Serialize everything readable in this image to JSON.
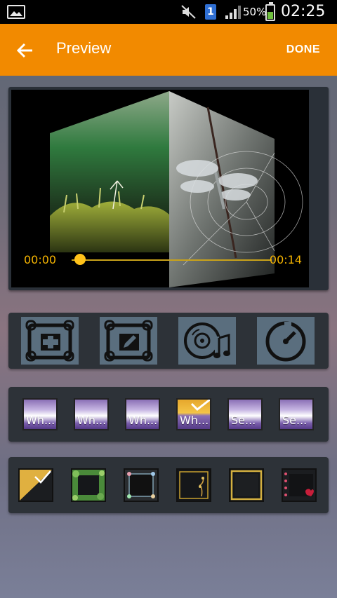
{
  "status_bar": {
    "battery_percent": "50%",
    "time": "02:25",
    "sim_slot": "1",
    "icons": [
      "gallery-icon",
      "mute-icon",
      "sim-icon",
      "signal-icon",
      "battery-icon"
    ]
  },
  "toolbar": {
    "title": "Preview",
    "done_label": "DONE",
    "accent_color": "#f28a00"
  },
  "player": {
    "current_time": "00:00",
    "total_time": "00:14",
    "progress": 0.0,
    "accent_color": "#ffc21a"
  },
  "tools": [
    {
      "name": "add-photo-icon"
    },
    {
      "name": "edit-photo-icon"
    },
    {
      "name": "music-disc-icon"
    },
    {
      "name": "duration-timer-icon"
    }
  ],
  "themes": [
    {
      "label": "Wh..."
    },
    {
      "label": "Wh..."
    },
    {
      "label": "Wh..."
    },
    {
      "label": "Wh...",
      "selected": true
    },
    {
      "label": "Se..."
    },
    {
      "label": "Se..."
    }
  ],
  "frames": [
    {
      "name": "frame-none",
      "selected": true
    },
    {
      "name": "frame-leaves"
    },
    {
      "name": "frame-flowers"
    },
    {
      "name": "frame-vine"
    },
    {
      "name": "frame-gold"
    },
    {
      "name": "frame-hearts"
    }
  ]
}
